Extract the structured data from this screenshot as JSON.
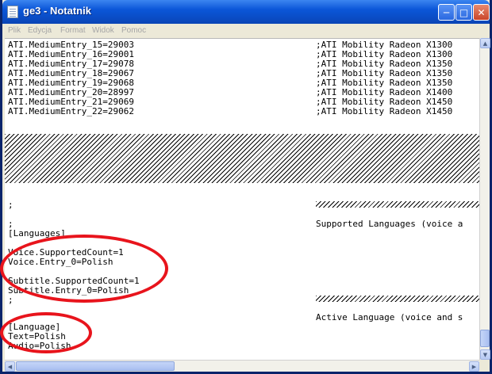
{
  "window": {
    "title": "ge3 - Notatnik"
  },
  "menu": [
    "Plik",
    "Edycja",
    "Format",
    "Widok",
    "Pomoc"
  ],
  "entries": [
    {
      "left": "ATI.MediumEntry_15=29003",
      "right": ";ATI Mobility Radeon X1300"
    },
    {
      "left": "ATI.MediumEntry_16=29001",
      "right": ";ATI Mobility Radeon X1300"
    },
    {
      "left": "ATI.MediumEntry_17=29078",
      "right": ";ATI Mobility Radeon X1350"
    },
    {
      "left": "ATI.MediumEntry_18=29067",
      "right": ";ATI Mobility Radeon X1350"
    },
    {
      "left": "ATI.MediumEntry_19=29068",
      "right": ";ATI Mobility Radeon X1350"
    },
    {
      "left": "ATI.MediumEntry_20=28997",
      "right": ";ATI Mobility Radeon X1400"
    },
    {
      "left": "ATI.MediumEntry_21=29069",
      "right": ";ATI Mobility Radeon X1450"
    },
    {
      "left": "ATI.MediumEntry_22=29062",
      "right": ";ATI Mobility Radeon X1450"
    }
  ],
  "section1": {
    "semicolon_a": ";",
    "semicolon_b": ";",
    "comment": "Supported Languages (voice a",
    "header": "[Languages]",
    "voice_count": "Voice.SupportedCount=1",
    "voice_entry": "Voice.Entry_0=Polish",
    "subtitle_count": "Subtitle.SupportedCount=1",
    "subtitle_entry": "Subtitle.Entry_0=Polish"
  },
  "section2": {
    "semicolon": ";",
    "comment": "Active Language (voice and s",
    "header": "[Language]",
    "text": "Text=Polish",
    "audio": "Audio=Polish"
  },
  "icons": {
    "minimize": "minimize-icon",
    "maximize": "maximize-icon",
    "close": "close-icon"
  },
  "colors": {
    "titlebar": "#0a4ec8",
    "annotation": "#e8141c"
  }
}
